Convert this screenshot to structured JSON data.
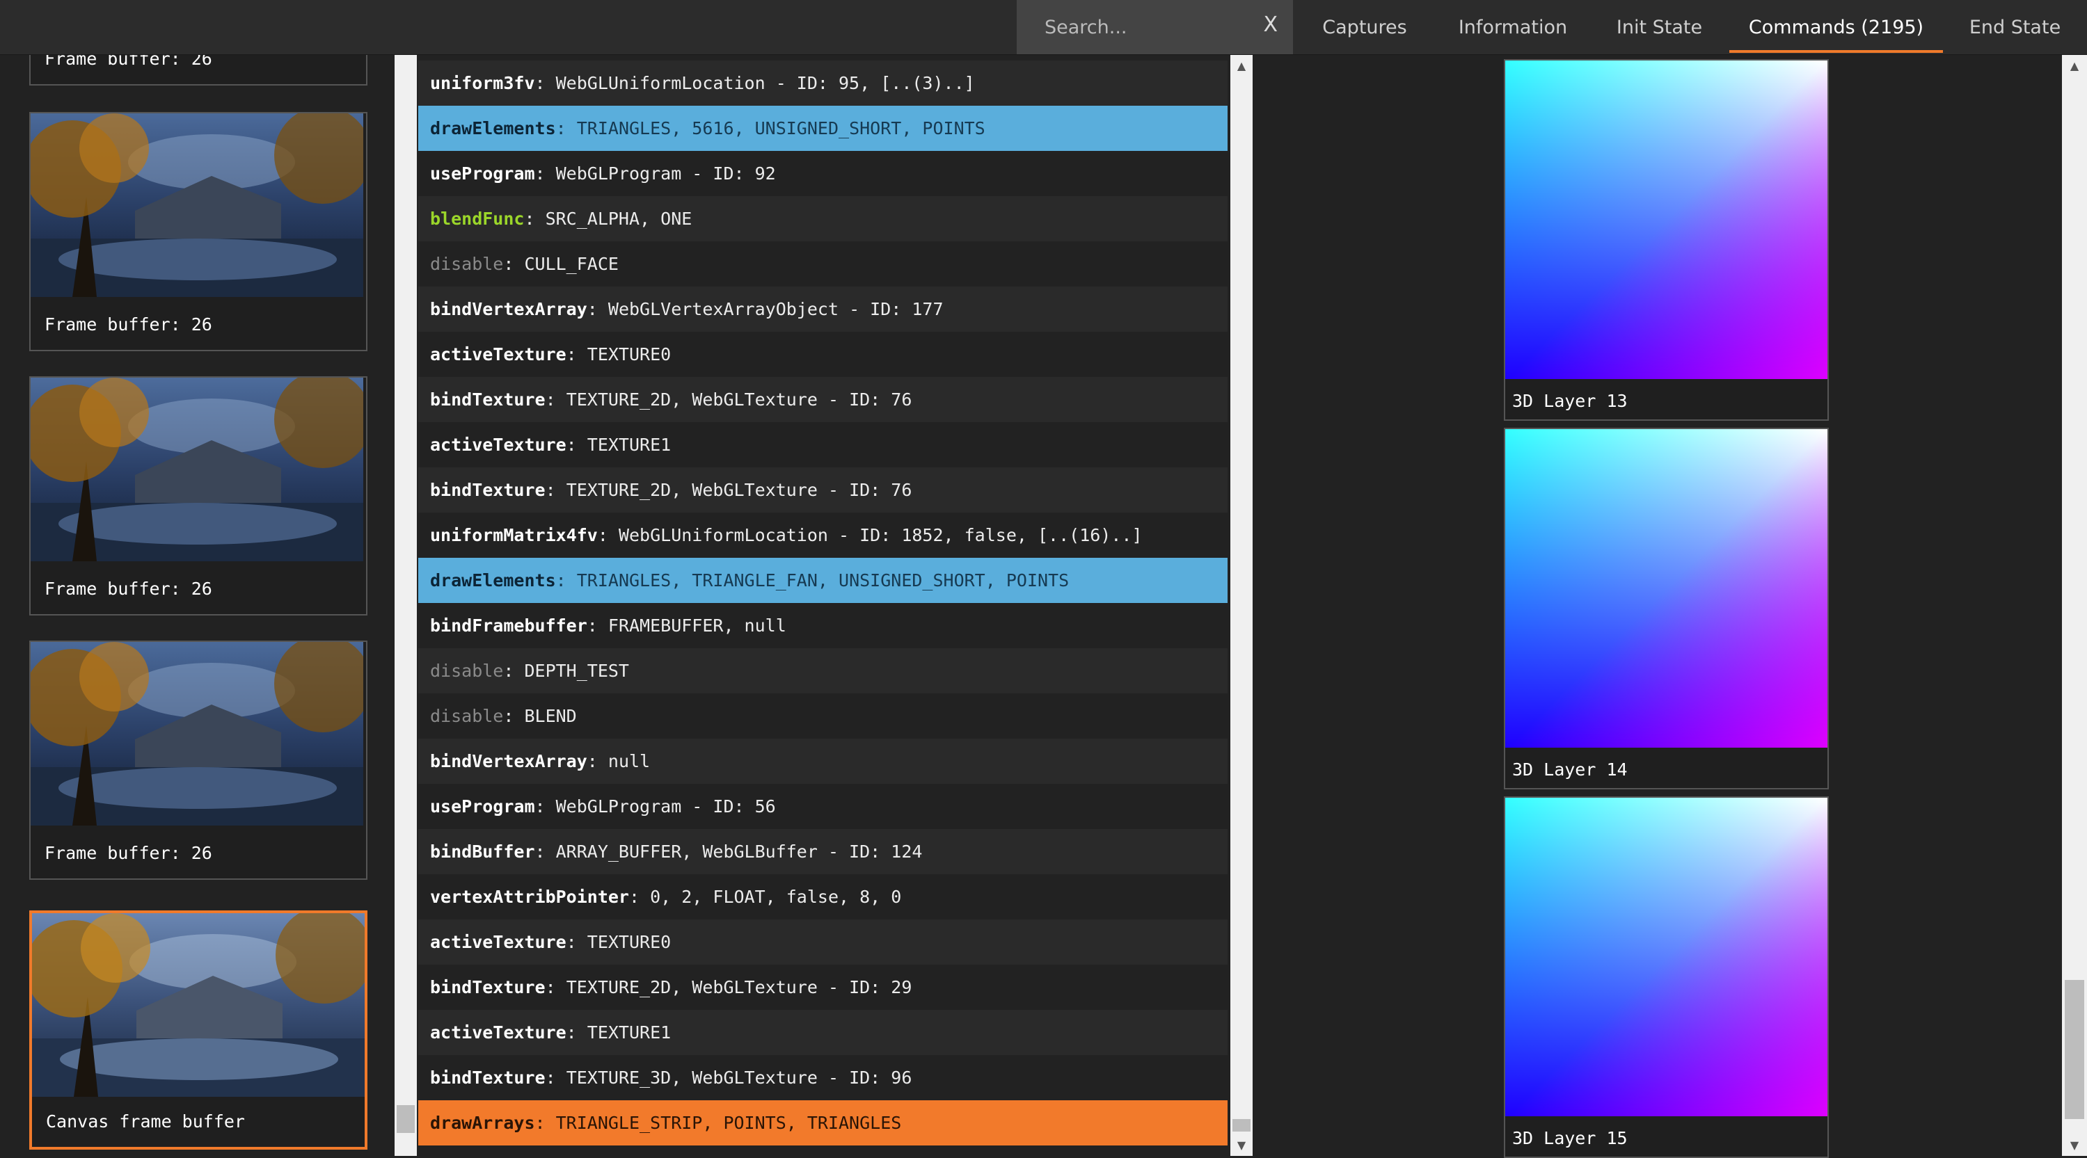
{
  "search": {
    "placeholder": "Search...",
    "clear_label": "X"
  },
  "tabs": [
    {
      "label": "Captures"
    },
    {
      "label": "Information"
    },
    {
      "label": "Init State"
    },
    {
      "label": "Commands (2195)"
    },
    {
      "label": "End State"
    }
  ],
  "thumbnails": [
    {
      "caption": "Frame buffer: 26"
    },
    {
      "caption": "Frame buffer: 26"
    },
    {
      "caption": "Frame buffer: 26"
    },
    {
      "caption": "Frame buffer: 26"
    },
    {
      "caption": "Canvas frame buffer"
    }
  ],
  "commands": [
    {
      "name": "uniform3fv",
      "args": "WebGLUniformLocation - ID: 95, [..(3)..]"
    },
    {
      "name": "drawElements",
      "args": "TRIANGLES, 5616, UNSIGNED_SHORT, POINTS"
    },
    {
      "name": "useProgram",
      "args": "WebGLProgram - ID: 92"
    },
    {
      "name": "blendFunc",
      "args": "SRC_ALPHA, ONE"
    },
    {
      "name": "disable",
      "args": "CULL_FACE"
    },
    {
      "name": "bindVertexArray",
      "args": "WebGLVertexArrayObject - ID: 177"
    },
    {
      "name": "activeTexture",
      "args": "TEXTURE0"
    },
    {
      "name": "bindTexture",
      "args": "TEXTURE_2D, WebGLTexture - ID: 76"
    },
    {
      "name": "activeTexture",
      "args": "TEXTURE1"
    },
    {
      "name": "bindTexture",
      "args": "TEXTURE_2D, WebGLTexture - ID: 76"
    },
    {
      "name": "uniformMatrix4fv",
      "args": "WebGLUniformLocation - ID: 1852, false, [..(16)..]"
    },
    {
      "name": "drawElements",
      "args": "TRIANGLES, TRIANGLE_FAN, UNSIGNED_SHORT, POINTS"
    },
    {
      "name": "bindFramebuffer",
      "args": "FRAMEBUFFER, null"
    },
    {
      "name": "disable",
      "args": "DEPTH_TEST"
    },
    {
      "name": "disable",
      "args": "BLEND"
    },
    {
      "name": "bindVertexArray",
      "args": "null"
    },
    {
      "name": "useProgram",
      "args": "WebGLProgram - ID: 56"
    },
    {
      "name": "bindBuffer",
      "args": "ARRAY_BUFFER, WebGLBuffer - ID: 124"
    },
    {
      "name": "vertexAttribPointer",
      "args": "0, 2, FLOAT, false, 8, 0"
    },
    {
      "name": "activeTexture",
      "args": "TEXTURE0"
    },
    {
      "name": "bindTexture",
      "args": "TEXTURE_2D, WebGLTexture - ID: 29"
    },
    {
      "name": "activeTexture",
      "args": "TEXTURE1"
    },
    {
      "name": "bindTexture",
      "args": "TEXTURE_3D, WebGLTexture - ID: 96"
    },
    {
      "name": "drawArrays",
      "args": "TRIANGLE_STRIP, POINTS, TRIANGLES"
    }
  ],
  "layers": [
    {
      "caption": "3D Layer 13"
    },
    {
      "caption": "3D Layer 14"
    },
    {
      "caption": "3D Layer 15"
    }
  ],
  "colors": {
    "accent": "#f07a2b",
    "draw_highlight": "#5aaedc",
    "blend_func": "#9bd62a",
    "disabled_fn": "#8a8a8a"
  }
}
